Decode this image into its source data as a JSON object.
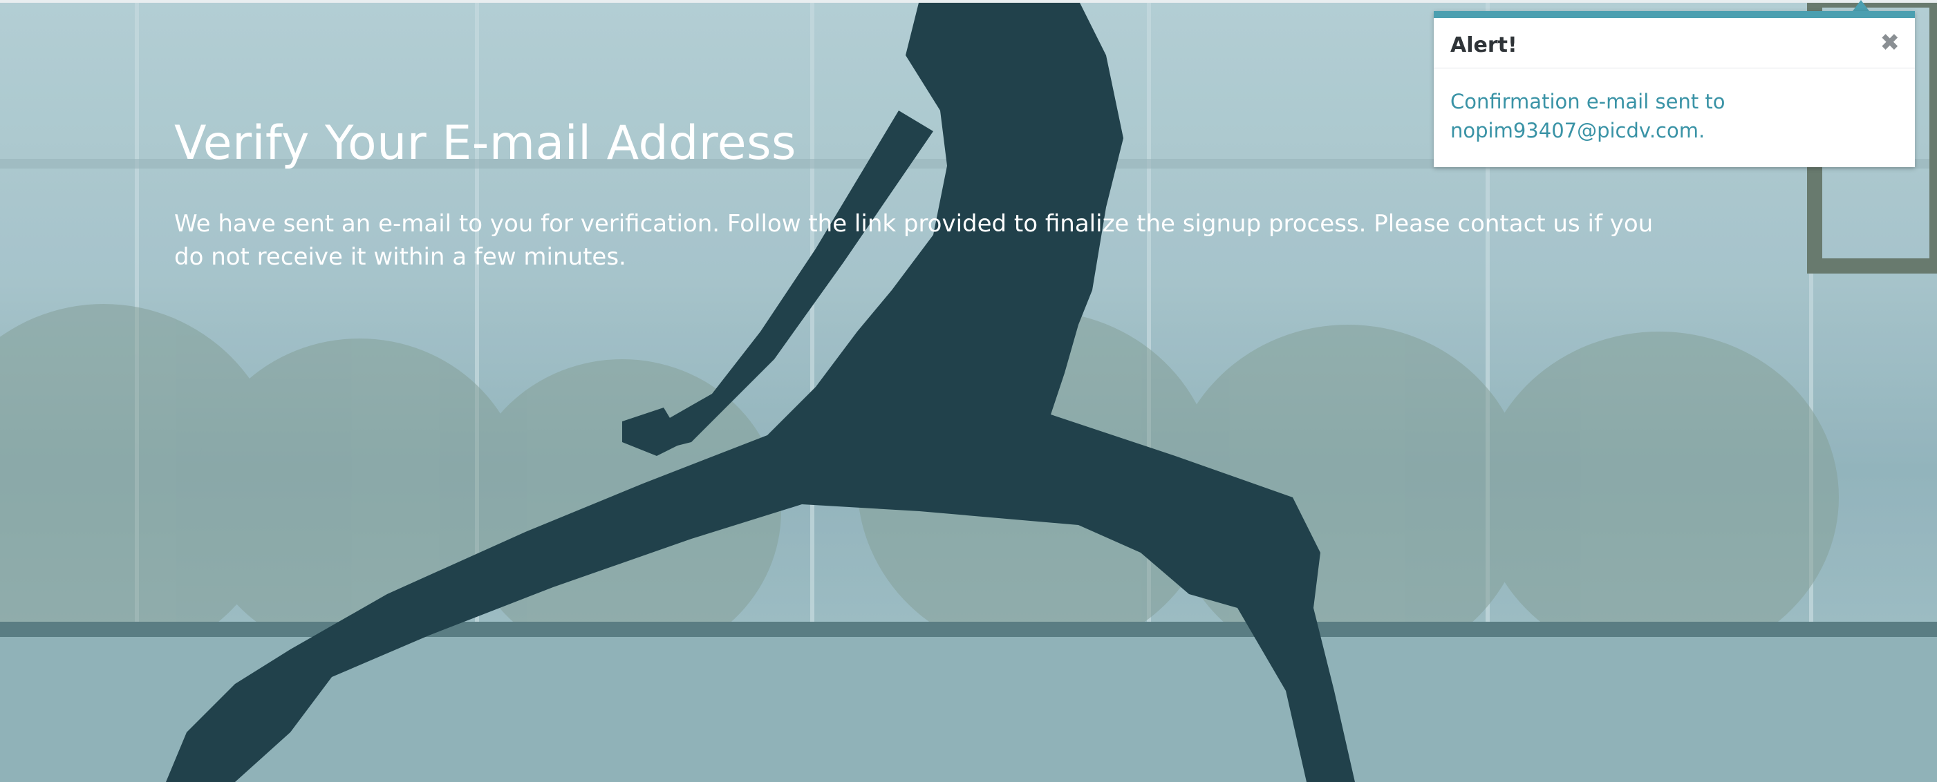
{
  "page": {
    "heading": "Verify Your E-mail Address",
    "message": "We have sent an e-mail to you for verification. Follow the link provided to finalize the signup process. Please contact us if you do not receive it within a few minutes."
  },
  "alert": {
    "title": "Alert!",
    "close_icon": "✖",
    "body": "Confirmation e-mail sent to nopim93407@picdv.com."
  },
  "colors": {
    "accent": "#4b9fb0",
    "alert_text": "#3a93a6",
    "silhouette": "#1e3a43"
  },
  "icons": {
    "close": "close-icon"
  }
}
